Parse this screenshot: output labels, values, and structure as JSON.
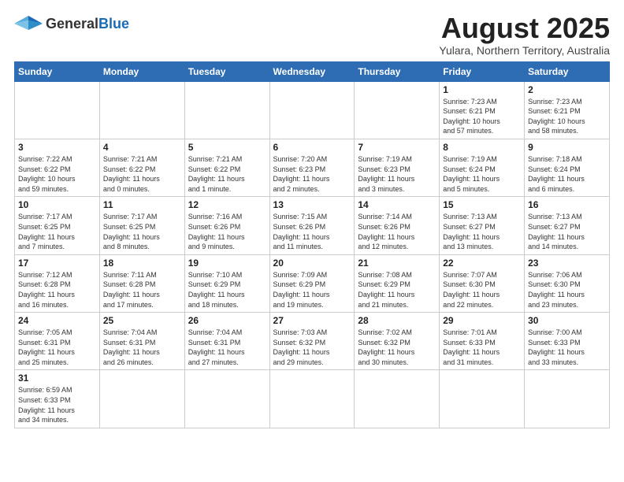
{
  "header": {
    "logo_general": "General",
    "logo_blue": "Blue",
    "title": "August 2025",
    "subtitle": "Yulara, Northern Territory, Australia"
  },
  "weekdays": [
    "Sunday",
    "Monday",
    "Tuesday",
    "Wednesday",
    "Thursday",
    "Friday",
    "Saturday"
  ],
  "weeks": [
    [
      {
        "day": "",
        "info": ""
      },
      {
        "day": "",
        "info": ""
      },
      {
        "day": "",
        "info": ""
      },
      {
        "day": "",
        "info": ""
      },
      {
        "day": "",
        "info": ""
      },
      {
        "day": "1",
        "info": "Sunrise: 7:23 AM\nSunset: 6:21 PM\nDaylight: 10 hours\nand 57 minutes."
      },
      {
        "day": "2",
        "info": "Sunrise: 7:23 AM\nSunset: 6:21 PM\nDaylight: 10 hours\nand 58 minutes."
      }
    ],
    [
      {
        "day": "3",
        "info": "Sunrise: 7:22 AM\nSunset: 6:22 PM\nDaylight: 10 hours\nand 59 minutes."
      },
      {
        "day": "4",
        "info": "Sunrise: 7:21 AM\nSunset: 6:22 PM\nDaylight: 11 hours\nand 0 minutes."
      },
      {
        "day": "5",
        "info": "Sunrise: 7:21 AM\nSunset: 6:22 PM\nDaylight: 11 hours\nand 1 minute."
      },
      {
        "day": "6",
        "info": "Sunrise: 7:20 AM\nSunset: 6:23 PM\nDaylight: 11 hours\nand 2 minutes."
      },
      {
        "day": "7",
        "info": "Sunrise: 7:19 AM\nSunset: 6:23 PM\nDaylight: 11 hours\nand 3 minutes."
      },
      {
        "day": "8",
        "info": "Sunrise: 7:19 AM\nSunset: 6:24 PM\nDaylight: 11 hours\nand 5 minutes."
      },
      {
        "day": "9",
        "info": "Sunrise: 7:18 AM\nSunset: 6:24 PM\nDaylight: 11 hours\nand 6 minutes."
      }
    ],
    [
      {
        "day": "10",
        "info": "Sunrise: 7:17 AM\nSunset: 6:25 PM\nDaylight: 11 hours\nand 7 minutes."
      },
      {
        "day": "11",
        "info": "Sunrise: 7:17 AM\nSunset: 6:25 PM\nDaylight: 11 hours\nand 8 minutes."
      },
      {
        "day": "12",
        "info": "Sunrise: 7:16 AM\nSunset: 6:26 PM\nDaylight: 11 hours\nand 9 minutes."
      },
      {
        "day": "13",
        "info": "Sunrise: 7:15 AM\nSunset: 6:26 PM\nDaylight: 11 hours\nand 11 minutes."
      },
      {
        "day": "14",
        "info": "Sunrise: 7:14 AM\nSunset: 6:26 PM\nDaylight: 11 hours\nand 12 minutes."
      },
      {
        "day": "15",
        "info": "Sunrise: 7:13 AM\nSunset: 6:27 PM\nDaylight: 11 hours\nand 13 minutes."
      },
      {
        "day": "16",
        "info": "Sunrise: 7:13 AM\nSunset: 6:27 PM\nDaylight: 11 hours\nand 14 minutes."
      }
    ],
    [
      {
        "day": "17",
        "info": "Sunrise: 7:12 AM\nSunset: 6:28 PM\nDaylight: 11 hours\nand 16 minutes."
      },
      {
        "day": "18",
        "info": "Sunrise: 7:11 AM\nSunset: 6:28 PM\nDaylight: 11 hours\nand 17 minutes."
      },
      {
        "day": "19",
        "info": "Sunrise: 7:10 AM\nSunset: 6:29 PM\nDaylight: 11 hours\nand 18 minutes."
      },
      {
        "day": "20",
        "info": "Sunrise: 7:09 AM\nSunset: 6:29 PM\nDaylight: 11 hours\nand 19 minutes."
      },
      {
        "day": "21",
        "info": "Sunrise: 7:08 AM\nSunset: 6:29 PM\nDaylight: 11 hours\nand 21 minutes."
      },
      {
        "day": "22",
        "info": "Sunrise: 7:07 AM\nSunset: 6:30 PM\nDaylight: 11 hours\nand 22 minutes."
      },
      {
        "day": "23",
        "info": "Sunrise: 7:06 AM\nSunset: 6:30 PM\nDaylight: 11 hours\nand 23 minutes."
      }
    ],
    [
      {
        "day": "24",
        "info": "Sunrise: 7:05 AM\nSunset: 6:31 PM\nDaylight: 11 hours\nand 25 minutes."
      },
      {
        "day": "25",
        "info": "Sunrise: 7:04 AM\nSunset: 6:31 PM\nDaylight: 11 hours\nand 26 minutes."
      },
      {
        "day": "26",
        "info": "Sunrise: 7:04 AM\nSunset: 6:31 PM\nDaylight: 11 hours\nand 27 minutes."
      },
      {
        "day": "27",
        "info": "Sunrise: 7:03 AM\nSunset: 6:32 PM\nDaylight: 11 hours\nand 29 minutes."
      },
      {
        "day": "28",
        "info": "Sunrise: 7:02 AM\nSunset: 6:32 PM\nDaylight: 11 hours\nand 30 minutes."
      },
      {
        "day": "29",
        "info": "Sunrise: 7:01 AM\nSunset: 6:33 PM\nDaylight: 11 hours\nand 31 minutes."
      },
      {
        "day": "30",
        "info": "Sunrise: 7:00 AM\nSunset: 6:33 PM\nDaylight: 11 hours\nand 33 minutes."
      }
    ],
    [
      {
        "day": "31",
        "info": "Sunrise: 6:59 AM\nSunset: 6:33 PM\nDaylight: 11 hours\nand 34 minutes."
      },
      {
        "day": "",
        "info": ""
      },
      {
        "day": "",
        "info": ""
      },
      {
        "day": "",
        "info": ""
      },
      {
        "day": "",
        "info": ""
      },
      {
        "day": "",
        "info": ""
      },
      {
        "day": "",
        "info": ""
      }
    ]
  ]
}
